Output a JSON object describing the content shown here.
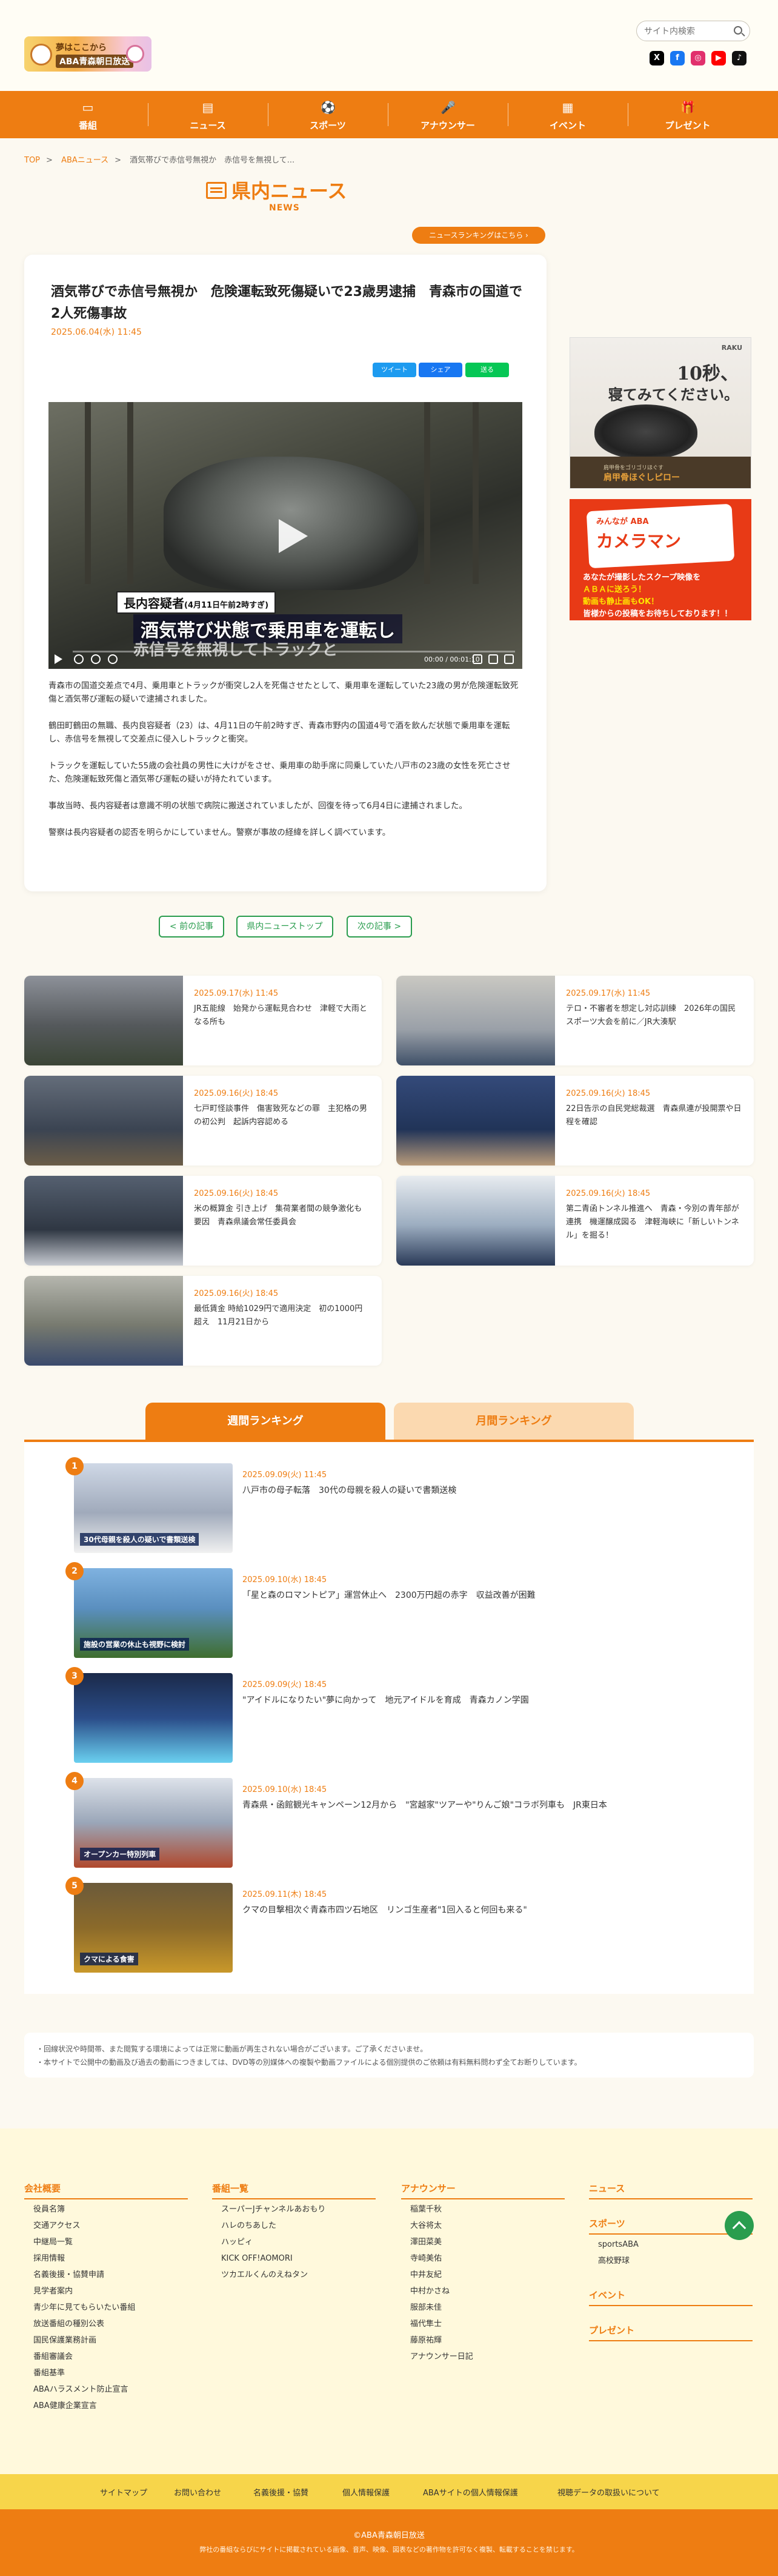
{
  "header": {
    "logo_line1": "夢はここから",
    "logo_line2": "ABA青森朝日放送",
    "search_placeholder": "サイト内検索",
    "sns": [
      {
        "icon": "x-icon",
        "label": "X",
        "color": "#000000"
      },
      {
        "icon": "facebook-icon",
        "label": "f",
        "color": "#1877f2"
      },
      {
        "icon": "instagram-icon",
        "label": "◎",
        "color": "#e1306c"
      },
      {
        "icon": "youtube-icon",
        "label": "▶",
        "color": "#ff0000"
      },
      {
        "icon": "tiktok-icon",
        "label": "♪",
        "color": "#111111"
      }
    ]
  },
  "nav": [
    {
      "icon": "tv-icon",
      "glyph": "▭",
      "label": "番組"
    },
    {
      "icon": "news-icon",
      "glyph": "▤",
      "label": "ニュース"
    },
    {
      "icon": "soccer-ball-icon",
      "glyph": "⚽",
      "label": "スポーツ"
    },
    {
      "icon": "microphone-icon",
      "glyph": "🎤",
      "label": "アナウンサー"
    },
    {
      "icon": "calendar-icon",
      "glyph": "▦",
      "label": "イベント"
    },
    {
      "icon": "gift-icon",
      "glyph": "🎁",
      "label": "プレゼント"
    }
  ],
  "breadcrumb": [
    "TOP",
    "ABAニュース",
    "酒気帯びで赤信号無視か　赤信号を無視して..."
  ],
  "page": {
    "title": "県内ニュース",
    "subtitle": "NEWS",
    "ranking_link": "ニュースランキングはこちら"
  },
  "article": {
    "title": "酒気帯びで赤信号無視か　危険運転致死傷疑いで23歳男逮捕　青森市の国道で2人死傷事故",
    "date": "2025.06.04(水) 11:45",
    "share": [
      {
        "label": "ツイート",
        "color": "#1d9bf0"
      },
      {
        "label": "シェア",
        "color": "#1877f2"
      },
      {
        "label": "送る",
        "color": "#06c755"
      }
    ],
    "video": {
      "caption_name": "長内容疑者",
      "caption_note": "(4月11日午前2時すぎ)",
      "caption_main": "酒気帯び状態で乗用車を運転し",
      "caption_sub": "赤信号を無視してトラックと",
      "time": "00:00 / 00:01:10"
    },
    "body": [
      "青森市の国道交差点で4月、乗用車とトラックが衝突し2人を死傷させたとして、乗用車を運転していた23歳の男が危険運転致死傷と酒気帯び運転の疑いで逮捕されました。",
      "鶴田町鶴田の無職、長内良容疑者（23）は、4月11日の午前2時すぎ、青森市野内の国道4号で酒を飲んだ状態で乗用車を運転し、赤信号を無視して交差点に侵入しトラックと衝突。",
      "トラックを運転していた55歳の会社員の男性に大けがをさせ、乗用車の助手席に同乗していた八戸市の23歳の女性を死亡させた、危険運転致死傷と酒気帯び運転の疑いが持たれています。",
      "事故当時、長内容疑者は意識不明の状態で病院に搬送されていましたが、回復を待って6月4日に逮捕されました。",
      "警察は長内容疑者の認否を明らかにしていません。警察が事故の経緯を詳しく調べています。"
    ]
  },
  "ads": {
    "ad1_brand": "RAKU",
    "ad1_head1": "10秒、",
    "ad1_head2": "寝てみてください。",
    "ad1_small": "肩甲骨をゴリゴリほぐす",
    "ad1_product": "肩甲骨ほぐしピロー",
    "ad2_top": "みんなが ABA",
    "ad2_title": "カメラマン",
    "ad2_l1": "あなたが撮影したスクープ映像を",
    "ad2_l2": "ＡＢＡに送ろう！",
    "ad2_l3": "動画も静止画もOK！",
    "ad2_l4": "皆様からの投稿をお待ちしております！！"
  },
  "pager": {
    "prev": "< 前の記事",
    "top": "県内ニューストップ",
    "next": "次の記事 >"
  },
  "news_list": [
    {
      "date": "2025.09.17(水) 11:45",
      "title": "JR五能線　始発から運転見合わせ　津軽で大雨となる所も"
    },
    {
      "date": "2025.09.17(水) 11:45",
      "title": "テロ・不審者を想定し対応訓練　2026年の国民スポーツ大会を前に／JR大湊駅"
    },
    {
      "date": "2025.09.16(火) 18:45",
      "title": "七戸町怪談事件　傷害致死などの罪　主犯格の男の初公判　起訴内容認める"
    },
    {
      "date": "2025.09.16(火) 18:45",
      "title": "22日告示の自民党総裁選　青森県連が投開票や日程を確認"
    },
    {
      "date": "2025.09.16(火) 18:45",
      "title": "米の概算金 引き上げ　集荷業者間の競争激化も要因　青森県議会常任委員会"
    },
    {
      "date": "2025.09.16(火) 18:45",
      "title": "第二青函トンネル推進へ　青森・今別の青年部が連携　機運醸成図る　津軽海峡に「新しいトンネル」を掘る！"
    },
    {
      "date": "2025.09.16(火) 18:45",
      "title": "最低賃金 時給1029円で適用決定　初の1000円超え　11月21日から"
    }
  ],
  "ranking": {
    "tab_weekly": "週間ランキング",
    "tab_monthly": "月間ランキング",
    "items": [
      {
        "rank": "1",
        "date": "2025.09.09(火) 11:45",
        "title": "八戸市の母子転落　30代の母親を殺人の疑いで書類送検",
        "thumb_caption": "30代母親を殺人の疑いで書類送検"
      },
      {
        "rank": "2",
        "date": "2025.09.10(水) 18:45",
        "title": "「星と森のロマントピア」運営休止へ　2300万円超の赤字　収益改善が困難",
        "thumb_caption": "施設の営業の休止も視野に検討"
      },
      {
        "rank": "3",
        "date": "2025.09.09(火) 18:45",
        "title": "\"アイドルになりたい\"夢に向かって　地元アイドルを育成　青森カノン学園",
        "thumb_caption": ""
      },
      {
        "rank": "4",
        "date": "2025.09.10(水) 18:45",
        "title": "青森県・函館観光キャンペーン12月から　\"宮越家\"ツアーや\"りんご娘\"コラボ列車も　JR東日本",
        "thumb_caption": "オープンカー特別列車"
      },
      {
        "rank": "5",
        "date": "2025.09.11(木) 18:45",
        "title": "クマの目撃相次ぐ青森市四ツ石地区　リンゴ生産者\"1回入ると何回も来る\"",
        "thumb_caption": "クマによる食害"
      }
    ]
  },
  "notes": [
    "・回線状況や時間帯、また閲覧する環境によっては正常に動画が再生されない場合がございます。ご了承くださいませ。",
    "・本サイトで公開中の動画及び過去の動画につきましては、DVD等の別媒体への複製や動画ファイルによる個別提供のご依頼は有料無料問わず全てお断りしています。"
  ],
  "footer": {
    "col1_head": "会社概要",
    "col1": [
      "役員名簿",
      "交通アクセス",
      "中継局一覧",
      "採用情報",
      "名義後援・協賛申請",
      "見学者案内",
      "青少年に見てもらいたい番組",
      "放送番組の種別公表",
      "国民保護業務計画",
      "番組審議会",
      "番組基準",
      "ABAハラスメント防止宣言",
      "ABA健康企業宣言"
    ],
    "col2_head": "番組一覧",
    "col2": [
      "スーパーJチャンネルあおもり",
      "ハレのちあした",
      "ハッピィ",
      "KICK OFF!AOMORI",
      "ツカエルくんのえねタン"
    ],
    "col3_head": "アナウンサー",
    "col3": [
      "稲葉千秋",
      "大谷将太",
      "澤田菜美",
      "寺崎美佑",
      "中井友紀",
      "中村かさね",
      "服部未佳",
      "福代隼士",
      "藤原祐輝",
      "アナウンサー日記"
    ],
    "col4_head1": "ニュース",
    "col4_head2": "スポーツ",
    "col4_sports": [
      "sportsABA",
      "高校野球"
    ],
    "col4_head3": "イベント",
    "col4_head4": "プレゼント",
    "bar": [
      "サイトマップ",
      "お問い合わせ",
      "名義後援・協賛",
      "個人情報保護",
      "ABAサイトの個人情報保護",
      "視聴データの取扱いについて"
    ],
    "copyright": "©ABA青森朝日放送",
    "disclaimer": "弊社の番組ならびにサイトに掲載されている画像、音声、映像、図表などの著作物を許可なく複製、転載することを禁じます。"
  }
}
